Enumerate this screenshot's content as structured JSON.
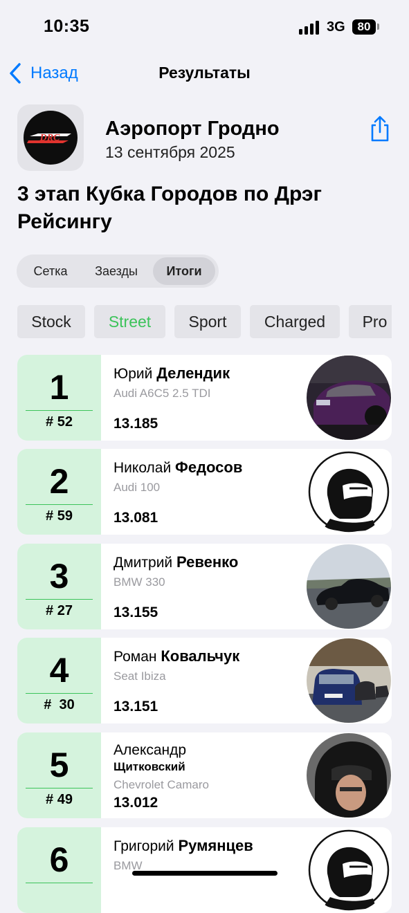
{
  "status_bar": {
    "time": "10:35",
    "network": "3G",
    "battery": "80"
  },
  "nav": {
    "back_label": "Назад",
    "title": "Результаты"
  },
  "event": {
    "logo_text": "DRC",
    "name": "Аэропорт Гродно",
    "date": "13 сентября 2025",
    "title": "3 этап Кубка Городов по Дрэг Рейсингу"
  },
  "segments": [
    {
      "label": "Сетка",
      "active": false
    },
    {
      "label": "Заезды",
      "active": false
    },
    {
      "label": "Итоги",
      "active": true
    }
  ],
  "categories": [
    {
      "label": "Stock",
      "active": false
    },
    {
      "label": "Street",
      "active": true
    },
    {
      "label": "Sport",
      "active": false
    },
    {
      "label": "Charged",
      "active": false
    },
    {
      "label": "Pro",
      "active": false
    }
  ],
  "colors": {
    "accent": "#007aff",
    "active_category": "#3cc35a",
    "rank_bg": "#d5f3dd"
  },
  "results": [
    {
      "rank": "1",
      "bib": "# 52",
      "first_name": "Юрий",
      "last_name": "Делендик",
      "car": "Audi A6C5 2.5 TDI",
      "time": "13.185",
      "avatar": "purple-car-photo"
    },
    {
      "rank": "2",
      "bib": "# 59",
      "first_name": "Николай",
      "last_name": "Федосов",
      "car": "Audi 100",
      "time": "13.081",
      "avatar": "helmet-icon"
    },
    {
      "rank": "3",
      "bib": "# 27",
      "first_name": "Дмитрий",
      "last_name": "Ревенко",
      "car": "BMW 330",
      "time": "13.155",
      "avatar": "black-bmw-photo"
    },
    {
      "rank": "4",
      "bib": "#  30",
      "first_name": "Роман",
      "last_name": "Ковальчук",
      "car": "Seat Ibiza",
      "time": "13.151",
      "avatar": "blue-seat-photo"
    },
    {
      "rank": "5",
      "bib": "# 49",
      "first_name": "Александр",
      "last_name": "Щитковский",
      "car": "Chevrolet Camaro",
      "time": "13.012",
      "avatar": "driver-in-helmet-photo"
    },
    {
      "rank": "6",
      "bib": "",
      "first_name": "Григорий",
      "last_name": "Румянцев",
      "car": "BMW",
      "time": "",
      "avatar": "helmet-icon"
    }
  ]
}
